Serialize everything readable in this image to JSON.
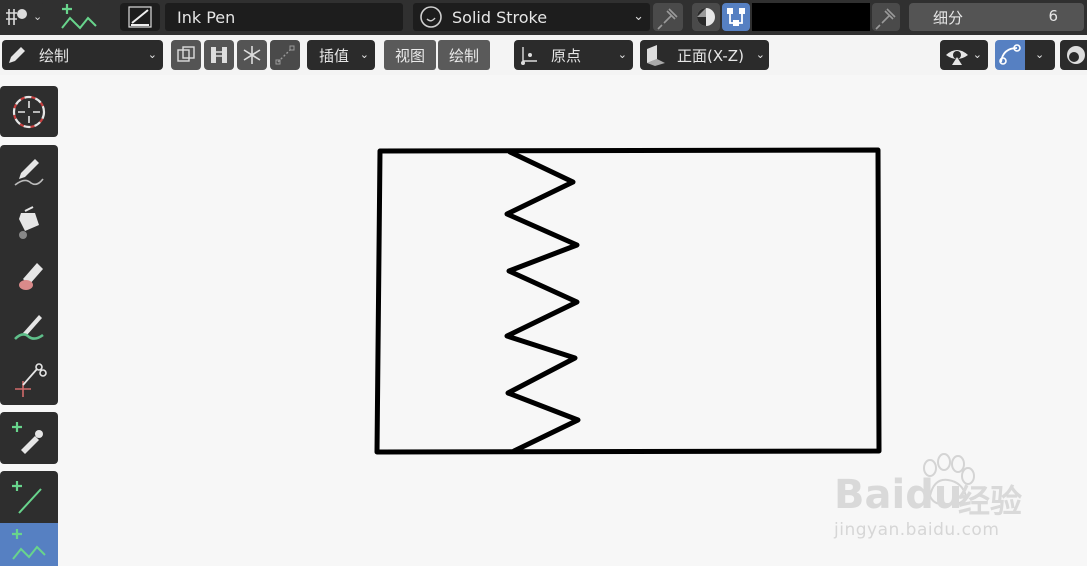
{
  "header": {
    "brush_name": "Ink Pen",
    "material_name": "Solid Stroke",
    "subdivision_label": "细分",
    "subdivision_value": "6",
    "icons": [
      "gp-mode-icon",
      "stroke-tool-icon",
      "brush-icon",
      "material-sphere-icon",
      "pin-icon",
      "color-mode-icon",
      "vertex-color-icon",
      "pin-icon"
    ],
    "stroke_color": "#000000"
  },
  "toolbar": {
    "mode_label": "绘制",
    "interpolate_label": "插值",
    "view_label": "视图",
    "draw_label": "绘制",
    "pivot_label": "原点",
    "orientation_label": "正面(X-Z)"
  },
  "left_tools": [
    {
      "name": "cursor-tool"
    },
    {
      "name": "draw-tool"
    },
    {
      "name": "fill-tool"
    },
    {
      "name": "erase-tool"
    },
    {
      "name": "tint-tool"
    },
    {
      "name": "cutter-tool"
    },
    {
      "name": "eyedropper-tool"
    },
    {
      "name": "line-tool"
    },
    {
      "name": "polyline-tool",
      "active": true
    }
  ],
  "watermark": {
    "brand": "Baidu",
    "sub": "经验",
    "url": "jingyan.baidu.com"
  },
  "colors": {
    "accent": "#5680c2",
    "panel": "#2e2e2e",
    "header": "#303030",
    "canvas": "#f7f7f7",
    "green_plus": "#68d48c"
  }
}
